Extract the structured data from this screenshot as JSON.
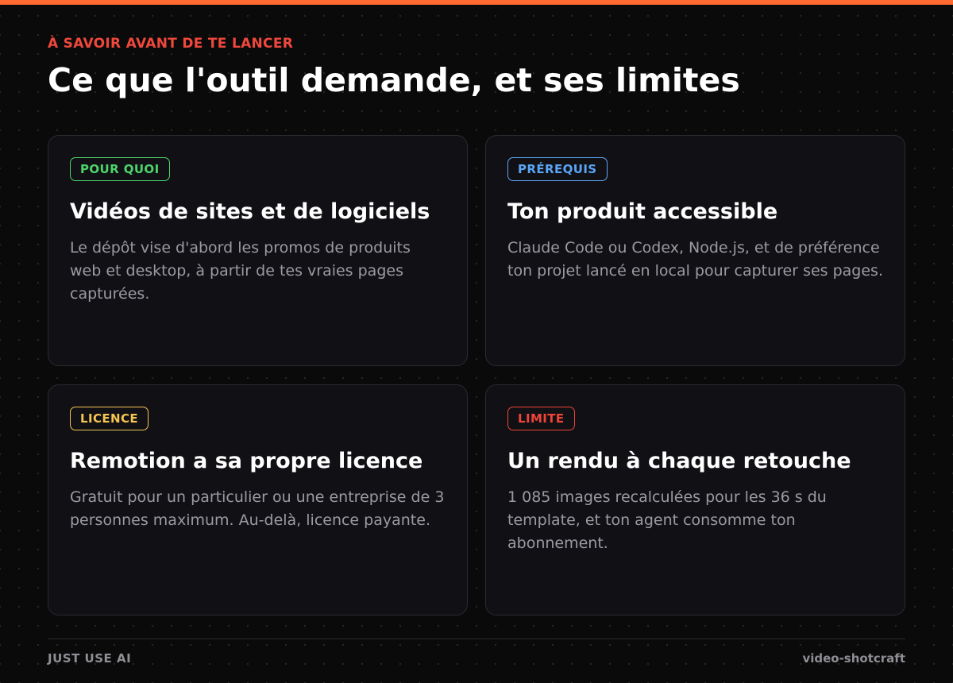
{
  "colors": {
    "accent": "#ff6a33",
    "eyebrow": "#f0483c"
  },
  "header": {
    "eyebrow": "À SAVOIR AVANT DE TE LANCER",
    "title": "Ce que l'outil demande, et ses limites"
  },
  "cards": [
    {
      "badge": "POUR QUOI",
      "badge_color": "#4ed36b",
      "title": "Vidéos de sites et de logiciels",
      "body": "Le dépôt vise d'abord les promos de produits web et desktop, à partir de tes vraies pages capturées."
    },
    {
      "badge": "PRÉREQUIS",
      "badge_color": "#5aa5f5",
      "title": "Ton produit accessible",
      "body": "Claude Code ou Codex, Node.js, et de préférence ton projet lancé en local pour capturer ses pages."
    },
    {
      "badge": "LICENCE",
      "badge_color": "#f5c451",
      "title": "Remotion a sa propre licence",
      "body": "Gratuit pour un particulier ou une entreprise de 3 personnes maximum. Au-delà, licence payante."
    },
    {
      "badge": "LIMITE",
      "badge_color": "#ef4438",
      "title": "Un rendu à chaque retouche",
      "body": "1 085 images recalculées pour les 36 s du template, et ton agent consomme ton abonnement."
    }
  ],
  "footer": {
    "left": "JUST USE AI",
    "right": "video-shotcraft"
  }
}
